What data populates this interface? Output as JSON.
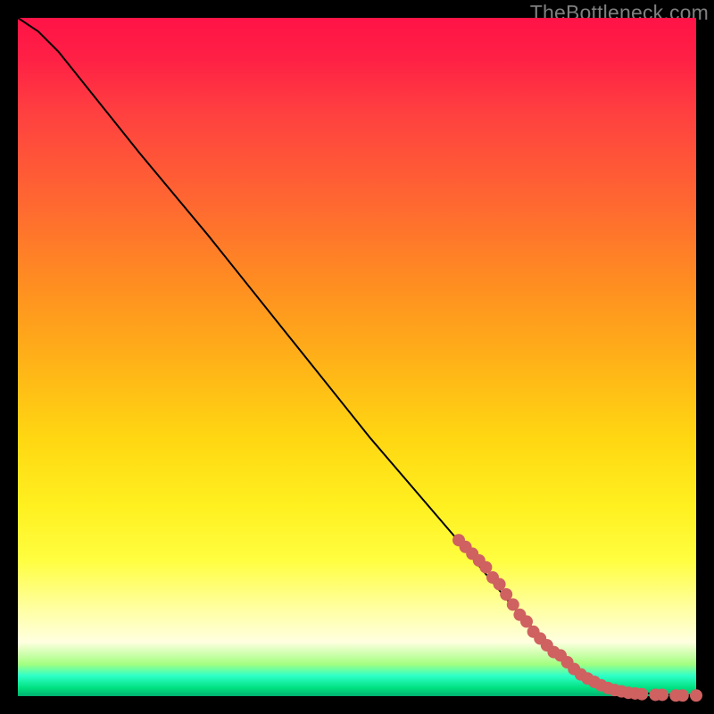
{
  "watermark": "TheBottleneck.com",
  "colors": {
    "background": "#000000",
    "curve": "#000000",
    "marker": "#cf6161",
    "watermark": "#7f7f7f"
  },
  "chart_data": {
    "type": "line",
    "title": "",
    "xlabel": "",
    "ylabel": "",
    "xlim": [
      0,
      100
    ],
    "ylim": [
      0,
      100
    ],
    "grid": false,
    "legend": false,
    "note": "Axes are unlabeled in the image; values below are estimated from pixel positions on a 0–100 normalized scale (x right, y up).",
    "series": [
      {
        "name": "curve",
        "x": [
          0,
          3,
          6,
          10,
          18,
          28,
          40,
          52,
          64,
          74,
          80,
          84,
          87,
          90,
          93,
          96,
          100
        ],
        "y": [
          100,
          98,
          95,
          90,
          80,
          68,
          53,
          38,
          24,
          12,
          6,
          3,
          1.5,
          0.8,
          0.4,
          0.2,
          0.1
        ]
      }
    ],
    "markers": {
      "name": "points-on-curve",
      "x": [
        65,
        66,
        67,
        68,
        69,
        70,
        71,
        72,
        73,
        74,
        75,
        76,
        77,
        78,
        79,
        80,
        81,
        82,
        83,
        84,
        85,
        86,
        87,
        88,
        89,
        90,
        91,
        92,
        94,
        95,
        97,
        98,
        100
      ],
      "y": [
        23,
        22,
        21,
        20,
        19,
        17.5,
        16.5,
        15,
        13.5,
        12,
        11,
        9.5,
        8.5,
        7.5,
        6.5,
        6,
        5,
        4,
        3.2,
        2.6,
        2.1,
        1.6,
        1.2,
        0.9,
        0.7,
        0.5,
        0.4,
        0.3,
        0.2,
        0.2,
        0.1,
        0.1,
        0.1
      ]
    }
  }
}
